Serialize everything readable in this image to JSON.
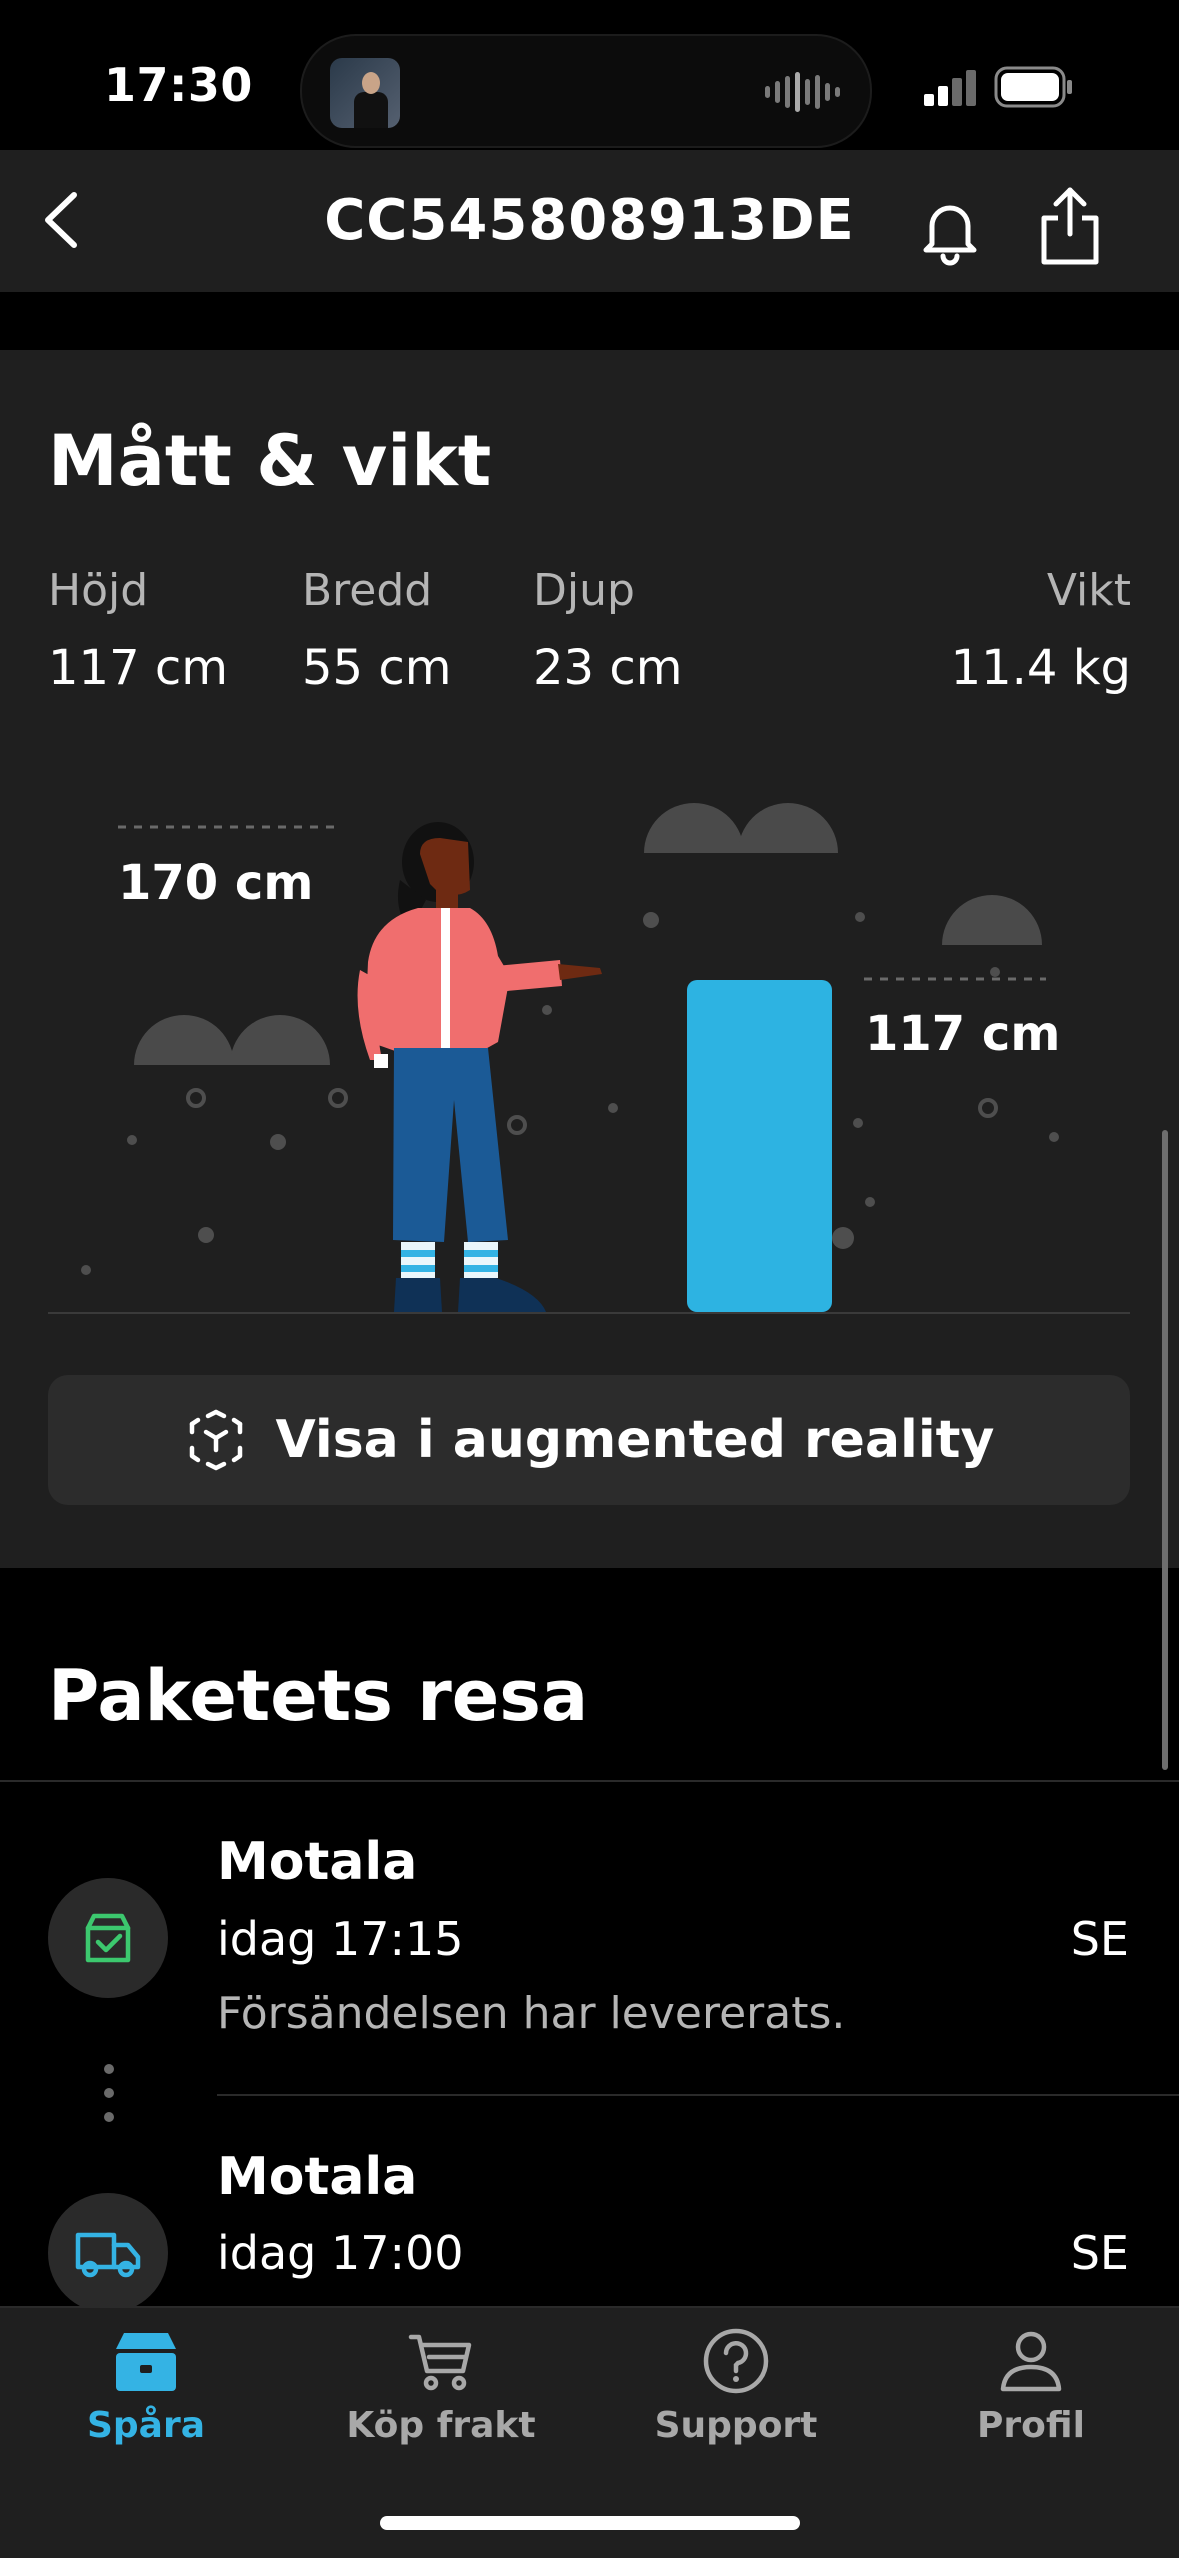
{
  "status": {
    "time": "17:30"
  },
  "header": {
    "title": "CC545808913DE"
  },
  "dimensions": {
    "title": "Mått & vikt",
    "labels": {
      "height": "Höjd",
      "width": "Bredd",
      "depth": "Djup",
      "weight": "Vikt"
    },
    "values": {
      "height": "117 cm",
      "width": "55 cm",
      "depth": "23 cm",
      "weight": "11.4 kg"
    },
    "illustration": {
      "person_height": "170 cm",
      "package_height": "117 cm"
    },
    "ar_button": "Visa i augmented reality"
  },
  "journey": {
    "title": "Paketets resa",
    "events": [
      {
        "city": "Motala",
        "time": "idag 17:15",
        "country": "SE",
        "description": "Försändelsen har levererats.",
        "icon": "package-delivered-icon"
      },
      {
        "city": "Motala",
        "time": "idag 17:00",
        "country": "SE",
        "icon": "truck-icon"
      }
    ]
  },
  "tabs": [
    {
      "label": "Spåra",
      "icon": "package-icon",
      "active": true
    },
    {
      "label": "Köp frakt",
      "icon": "cart-icon",
      "active": false
    },
    {
      "label": "Support",
      "icon": "help-icon",
      "active": false
    },
    {
      "label": "Profil",
      "icon": "profile-icon",
      "active": false
    }
  ],
  "colors": {
    "accent": "#34b3e4",
    "success": "#3cc86e",
    "card": "#1f1f1f"
  }
}
